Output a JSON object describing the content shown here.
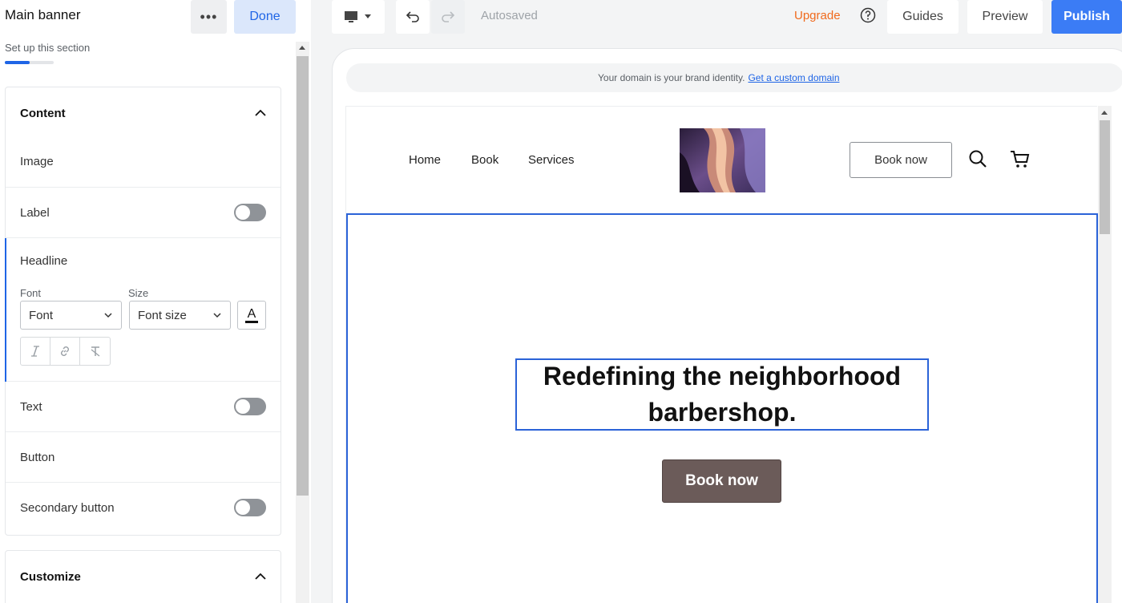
{
  "panel": {
    "title": "Main banner",
    "more_label": "•••",
    "done_label": "Done",
    "subtitle": "Set up this section",
    "progress_fraction": 0.5
  },
  "content_card": {
    "title": "Content",
    "rows": {
      "image": "Image",
      "label": "Label",
      "text": "Text",
      "button": "Button",
      "secondary_button": "Secondary button"
    },
    "headline": {
      "title": "Headline",
      "font_label": "Font",
      "font_value": "Font",
      "size_label": "Size",
      "size_value": "Font size",
      "color_button_letter": "A"
    }
  },
  "customize_card": {
    "title": "Customize"
  },
  "topbar": {
    "autosaved": "Autosaved",
    "upgrade": "Upgrade",
    "guides": "Guides",
    "preview": "Preview",
    "publish": "Publish"
  },
  "domain_banner": {
    "text": "Your domain is your brand identity.",
    "link": "Get a custom domain"
  },
  "site": {
    "nav": [
      "Home",
      "Book",
      "Services"
    ],
    "book_now_header": "Book now",
    "headline_line1": "Redefining the neighborhood",
    "headline_line2": "barbershop.",
    "cta": "Book now"
  },
  "colors": {
    "accent": "#1f65e6",
    "publish": "#3b7cf5",
    "upgrade": "#f06a1d",
    "cta": "#6b5b59"
  }
}
